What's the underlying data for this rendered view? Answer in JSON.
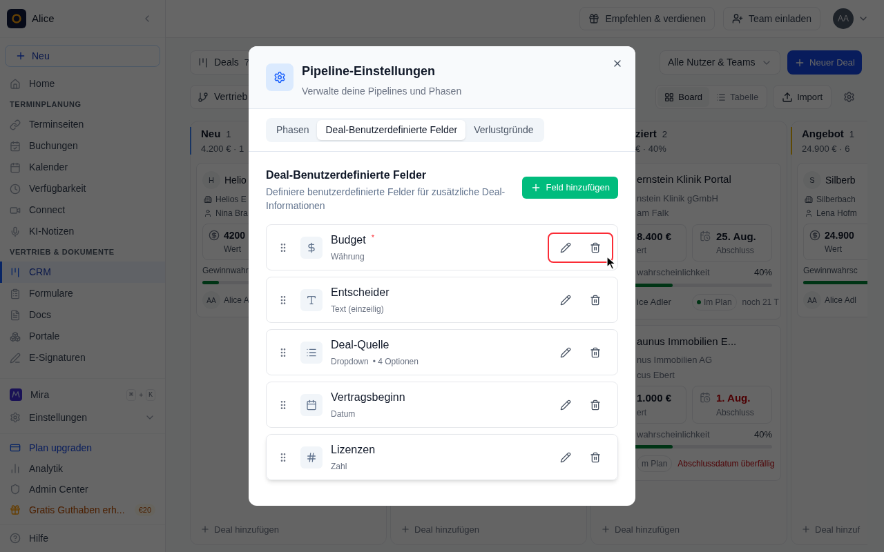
{
  "sidebar": {
    "workspace": "Alice",
    "new_button": "Neu",
    "sections": [
      {
        "items": [
          {
            "label": "Home",
            "selected": false
          }
        ]
      },
      {
        "title": "TERMINPLANUNG",
        "items": [
          {
            "label": "Terminseiten",
            "selected": false
          },
          {
            "label": "Buchungen",
            "selected": false
          },
          {
            "label": "Kalender",
            "selected": false
          },
          {
            "label": "Verfügbarkeit",
            "selected": false
          },
          {
            "label": "Connect",
            "selected": false
          },
          {
            "label": "KI-Notizen",
            "selected": false
          }
        ]
      },
      {
        "title": "VERTRIEB & DOKUMENTE",
        "items": [
          {
            "label": "CRM",
            "selected": true
          },
          {
            "label": "Formulare",
            "selected": false
          },
          {
            "label": "Docs",
            "selected": false
          },
          {
            "label": "Portale",
            "selected": false
          },
          {
            "label": "E-Signaturen",
            "selected": false
          }
        ]
      }
    ],
    "assistant": {
      "label": "Mira",
      "shortcut": [
        "⌘",
        "+",
        "K"
      ]
    },
    "settings": {
      "label": "Einstellungen",
      "expanded": false
    },
    "footer_items": [
      {
        "kind": "upgrade",
        "label": "Plan upgraden"
      },
      {
        "kind": "plain",
        "label": "Analytik"
      },
      {
        "kind": "plain",
        "label": "Admin Center"
      },
      {
        "kind": "promo",
        "label": "Gratis Guthaben erh...",
        "badge": "€20"
      }
    ],
    "help": "Hilfe"
  },
  "topbar": {
    "refer_button": "Empfehlen & verdienen",
    "invite_button": "Team einladen",
    "avatar": "AA"
  },
  "toolbar": {
    "pipeline": {
      "title": "Deals",
      "count": "7"
    },
    "pipeline_select": "Vertrieb",
    "owner_filter": "Alle Nutzer & Teams",
    "new_deal_button": "Neuer Deal",
    "views": [
      {
        "label": "Board",
        "selected": true
      },
      {
        "label": "Tabelle",
        "selected": false
      }
    ],
    "import_button": "Import"
  },
  "board": {
    "columns": [
      {
        "kind": "full",
        "title": "Neu",
        "count": "1",
        "summary": "4.200 € · 1",
        "color": "#183462",
        "add_label": "Deal hinzufügen",
        "cards": [
          {
            "avatar": "H",
            "title": "Helio",
            "company": "Helios E",
            "contact": "Nina Bra",
            "value": "4200",
            "value_label": "Wert",
            "probability_label": "Gewinnwahr",
            "level": 0.1,
            "owner_avatar": "AA",
            "owner": "Alice A"
          }
        ]
      },
      {
        "kind": "hidden",
        "add_label": "Deal hinzufügen"
      },
      {
        "kind": "partial",
        "title": "ziert",
        "count": "2",
        "summary": "€ · 40%",
        "add_label": "Deal hinzufügen",
        "cards": [
          {
            "title": "ernstein Klinik Portal",
            "company": "nstein Klinik gGmbH",
            "contact": "am Falk",
            "value": "8.400 €",
            "value_label": "ert",
            "close_date": "25. Aug.",
            "close_label": "Abschluss",
            "overdue": false,
            "probability_label": "wahrscheinlichkeit",
            "probability": "40%",
            "level": 0.4,
            "owner": "ice Adler",
            "status": "Im Plan",
            "status_dot": true,
            "due": "noch 21 T"
          },
          {
            "title": "aunus Immobilien E...",
            "company": "nus Immobilien AG",
            "contact": "cus Ebert",
            "value": "1.000 €",
            "value_label": "ert",
            "close_date": "1. Aug.",
            "close_label": "Abschluss",
            "overdue": true,
            "probability_label": "wahrscheinlichkeit",
            "probability": "40%",
            "level": 0.4,
            "status": "m Plan",
            "status_dot": false,
            "due": "Abschlussdatum überfällig"
          }
        ]
      },
      {
        "kind": "full",
        "title": "Angebot",
        "count": "1",
        "summary": "24.900 € · 6",
        "color": "#5e4803",
        "add_label": "Deal hinzuf",
        "cards": [
          {
            "avatar": "S",
            "title": "Silberb",
            "company": "Silberbach",
            "contact": "Lena Hofm",
            "value": "24.900",
            "value_label": "Wert",
            "probability_label": "Gewinnwahrsc",
            "level": 0.6,
            "owner_avatar": "AA",
            "owner": "Alice Adl"
          }
        ]
      }
    ]
  },
  "dialog": {
    "title": "Pipeline-Einstellungen",
    "subtitle": "Verwalte deine Pipelines und Phasen",
    "tabs": [
      {
        "label": "Phasen",
        "selected": false
      },
      {
        "label": "Deal-Benutzerdefinierte Felder",
        "selected": true
      },
      {
        "label": "Verlustgründe",
        "selected": false
      }
    ],
    "section_title": "Deal-Benutzerdefinierte Felder",
    "section_description": "Definiere benutzerdefinierte Felder für zusätzliche Deal-Informationen",
    "add_button": "Feld hinzufügen",
    "fields": [
      {
        "kind": "currency",
        "name": "Budget",
        "required_mark": "*",
        "type": "Währung",
        "highlighted": true,
        "hovered": false
      },
      {
        "kind": "text",
        "name": "Entscheider",
        "type": "Text (einzeilig)",
        "highlighted": false,
        "hovered": false
      },
      {
        "kind": "select",
        "name": "Deal-Quelle",
        "type": "Dropdown",
        "options": "• 4 Optionen",
        "highlighted": false,
        "hovered": false
      },
      {
        "kind": "date",
        "name": "Vertragsbeginn",
        "type": "Datum",
        "highlighted": false,
        "hovered": false
      },
      {
        "kind": "number",
        "name": "Lizenzen",
        "type": "Zahl",
        "highlighted": false,
        "hovered": true
      }
    ]
  }
}
